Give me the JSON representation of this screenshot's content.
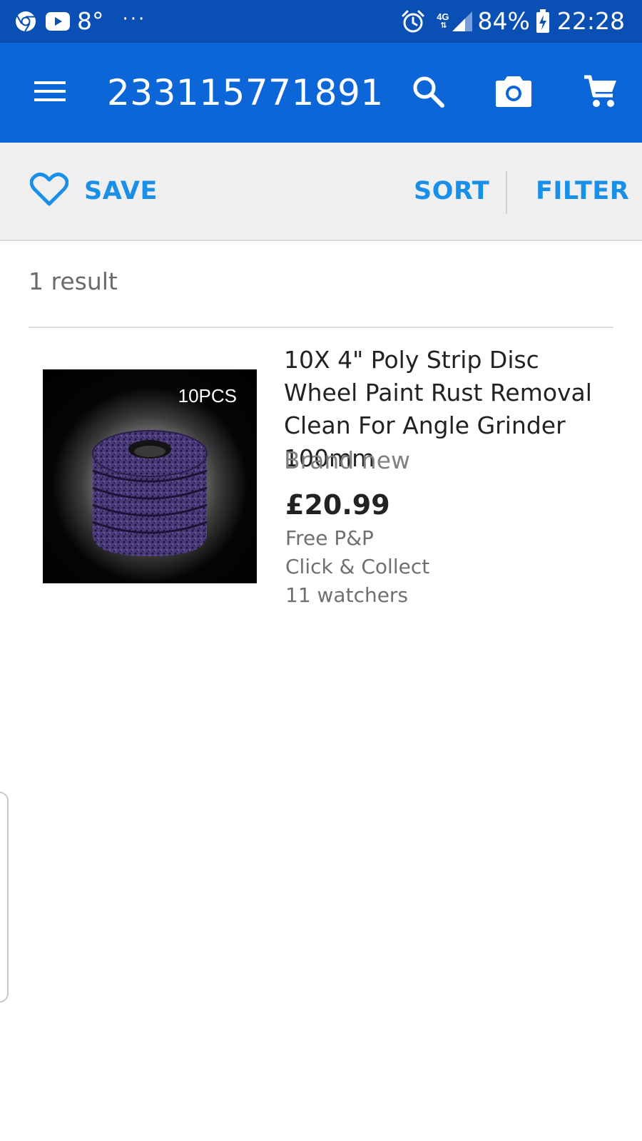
{
  "status_bar": {
    "temperature": "8°",
    "overflow": "···",
    "network": "4G",
    "battery": "84%",
    "time": "22:28",
    "icons": [
      "chrome-icon",
      "youtube-icon",
      "alarm-icon",
      "signal-icon",
      "battery-icon"
    ]
  },
  "app_bar": {
    "title": "233115771891",
    "icons": [
      "menu-icon",
      "search-icon",
      "camera-icon",
      "cart-icon"
    ]
  },
  "actions": {
    "save_label": "SAVE",
    "sort_label": "SORT",
    "filter_label": "FILTER"
  },
  "results": {
    "count_text": "1 result",
    "items": [
      {
        "title": "10X 4\" Poly Strip Disc Wheel Paint Rust Removal Clean For Angle Grinder 100mm",
        "image_badge": "10PCS",
        "condition": "Brand new",
        "price": "£20.99",
        "shipping": "Free P&P",
        "collection": "Click & Collect",
        "watchers": "11 watchers"
      }
    ]
  },
  "colors": {
    "status_bar": "#0a4fb3",
    "app_bar": "#0c66d8",
    "accent": "#1a8fe8",
    "action_bar_bg": "#efefef",
    "product_purple": "#4a3a7a"
  }
}
